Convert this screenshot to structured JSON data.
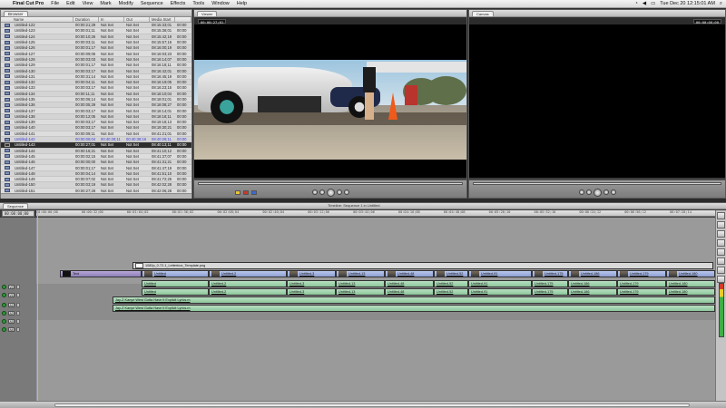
{
  "menubar": {
    "app": "Final Cut Pro",
    "items": [
      "File",
      "Edit",
      "View",
      "Mark",
      "Modify",
      "Sequence",
      "Effects",
      "Tools",
      "Window",
      "Help"
    ],
    "clock": "Tue Dec 20 12:15:01 AM"
  },
  "browser": {
    "tab": "Browser",
    "columns": [
      "Name",
      "Duration",
      "In",
      "Out",
      "Media Start",
      ""
    ],
    "rows": [
      {
        "name": "Untitled-122",
        "dur": "00:00:21;29",
        "in": "Not Set",
        "out": "Not Set",
        "mst": "08:15:33;01",
        "x": "00:00"
      },
      {
        "name": "Untitled-123",
        "dur": "00:00:01;11",
        "in": "Not Set",
        "out": "Not Set",
        "mst": "08:15:36;01",
        "x": "00:00"
      },
      {
        "name": "Untitled-124",
        "dur": "00:00:10;26",
        "in": "Not Set",
        "out": "Not Set",
        "mst": "08:15:42;19",
        "x": "00:00"
      },
      {
        "name": "Untitled-125",
        "dur": "00:00:03;11",
        "in": "Not Set",
        "out": "Not Set",
        "mst": "08:15:57;16",
        "x": "00:00"
      },
      {
        "name": "Untitled-126",
        "dur": "00:00:01;17",
        "in": "Not Set",
        "out": "Not Set",
        "mst": "08:16:00;19",
        "x": "00:00"
      },
      {
        "name": "Untitled-127",
        "dur": "00:00:09;06",
        "in": "Not Set",
        "out": "Not Set",
        "mst": "08:16:03;23",
        "x": "00:00"
      },
      {
        "name": "Untitled-128",
        "dur": "00:00:03;03",
        "in": "Not Set",
        "out": "Not Set",
        "mst": "08:16:14;07",
        "x": "00:00"
      },
      {
        "name": "Untitled-129",
        "dur": "00:00:01;17",
        "in": "Not Set",
        "out": "Not Set",
        "mst": "08:16:18;11",
        "x": "00:00"
      },
      {
        "name": "Untitled-130",
        "dur": "00:00:03;17",
        "in": "Not Set",
        "out": "Not Set",
        "mst": "08:16:42;01",
        "x": "00:00"
      },
      {
        "name": "Untitled-131",
        "dur": "00:00:31;14",
        "in": "Not Set",
        "out": "Not Set",
        "mst": "08:16:45;19",
        "x": "00:00"
      },
      {
        "name": "Untitled-132",
        "dur": "00:00:04;11",
        "in": "Not Set",
        "out": "Not Set",
        "mst": "08:16:19;05",
        "x": "00:00"
      },
      {
        "name": "Untitled-133",
        "dur": "00:00:03;17",
        "in": "Not Set",
        "out": "Not Set",
        "mst": "08:16:23;15",
        "x": "00:00"
      },
      {
        "name": "Untitled-134",
        "dur": "00:00:11;11",
        "in": "Not Set",
        "out": "Not Set",
        "mst": "08:18:10;04",
        "x": "00:00"
      },
      {
        "name": "Untitled-135",
        "dur": "00:00:06;14",
        "in": "Not Set",
        "out": "Not Set",
        "mst": "08:18:01;01",
        "x": "00:00"
      },
      {
        "name": "Untitled-136",
        "dur": "00:00:05;29",
        "in": "Not Set",
        "out": "Not Set",
        "mst": "08:18:08;27",
        "x": "00:00"
      },
      {
        "name": "Untitled-137",
        "dur": "00:00:03;17",
        "in": "Not Set",
        "out": "Not Set",
        "mst": "08:18:14;01",
        "x": "00:00"
      },
      {
        "name": "Untitled-138",
        "dur": "00:00:12;05",
        "in": "Not Set",
        "out": "Not Set",
        "mst": "08:18:18;11",
        "x": "00:00"
      },
      {
        "name": "Untitled-139",
        "dur": "00:00:03;17",
        "in": "Not Set",
        "out": "Not Set",
        "mst": "08:19:18;13",
        "x": "00:00"
      },
      {
        "name": "Untitled-140",
        "dur": "00:00:03;17",
        "in": "Not Set",
        "out": "Not Set",
        "mst": "08:19:30;21",
        "x": "00:00"
      },
      {
        "name": "Untitled-141",
        "dur": "00:00:09;11",
        "in": "Not Set",
        "out": "Not Set",
        "mst": "08:41:21;01",
        "x": "00:00"
      },
      {
        "name": "Untitled-142",
        "dur": "00:00:06;04",
        "in": "00:40:28;11",
        "out": "00:40:36;16",
        "mst": "08:40:28;11",
        "x": "00:00",
        "state": "hl"
      },
      {
        "name": "Untitled-143",
        "dur": "00:00:27;01",
        "in": "Not Set",
        "out": "Not Set",
        "mst": "08:40:13;11",
        "x": "00:00",
        "state": "sel"
      },
      {
        "name": "Untitled-144",
        "dur": "00:00:16;21",
        "in": "Not Set",
        "out": "Not Set",
        "mst": "08:41:10;12",
        "x": "00:00"
      },
      {
        "name": "Untitled-145",
        "dur": "00:00:02;15",
        "in": "Not Set",
        "out": "Not Set",
        "mst": "08:41:37;07",
        "x": "00:00"
      },
      {
        "name": "Untitled-146",
        "dur": "00:00:00;00",
        "in": "Not Set",
        "out": "Not Set",
        "mst": "08:41:31;21",
        "x": "00:00"
      },
      {
        "name": "Untitled-147",
        "dur": "00:00:01;17",
        "in": "Not Set",
        "out": "Not Set",
        "mst": "08:41:47;19",
        "x": "00:00"
      },
      {
        "name": "Untitled-148",
        "dur": "00:00:04;14",
        "in": "Not Set",
        "out": "Not Set",
        "mst": "08:41:51;10",
        "x": "00:00"
      },
      {
        "name": "Untitled-149",
        "dur": "00:00:07;02",
        "in": "Not Set",
        "out": "Not Set",
        "mst": "08:41:72;25",
        "x": "00:00"
      },
      {
        "name": "Untitled-150",
        "dur": "00:00:03;19",
        "in": "Not Set",
        "out": "Not Set",
        "mst": "08:42:02;28",
        "x": "00:00"
      },
      {
        "name": "Untitled-151",
        "dur": "00:00:27;28",
        "in": "Not Set",
        "out": "Not Set",
        "mst": "08:42:06;28",
        "x": "00:00"
      },
      {
        "name": "Untitled-152",
        "dur": "00:00:03;15",
        "in": "Not Set",
        "out": "Not Set",
        "mst": "08:42:14;13",
        "x": "00:00"
      },
      {
        "name": "Untitled-153",
        "dur": "00:00:03;13",
        "in": "Not Set",
        "out": "Not Set",
        "mst": "08:42:19;29",
        "x": "00:00"
      }
    ]
  },
  "viewer": {
    "tab": "Viewer",
    "duration": "00:00:27;01",
    "zoom": "26%",
    "timecode": "08:40:13;11"
  },
  "canvas": {
    "tab": "Canvas",
    "timecode": "00:00:00;00",
    "zoom": "26%"
  },
  "timeline": {
    "tab": "Sequence",
    "title": "Timeline: Sequence 1 in Untitled",
    "current_tc": "00:00:00;00",
    "ruler_ticks": [
      "00:00:00;00",
      "00:00:32;00",
      "00:01:04;02",
      "00:01:36;02",
      "00:02:08;04",
      "00:02:40;04",
      "00:03:12;06",
      "00:03:44;06",
      "00:04:16;08",
      "00:04:48;08",
      "00:05:20;10",
      "00:05:52;10",
      "00:06:24;12",
      "00:06:56;12",
      "00:07:28;14"
    ],
    "tracks": {
      "v2_label": "1080p_0.72-1_Letterbox_Template.png",
      "v1_title": "Text",
      "v1_clips": [
        "Untitled",
        "Untitled-2",
        "Untitled-3",
        "Untitled-13",
        "Untitled-48",
        "Untitled-52",
        "Untitled-91",
        "Untitled-175",
        "Untitled-186",
        "Untitled-179",
        "Untitled-180"
      ],
      "a1_clips": [
        "Untitled",
        "Untitled-2",
        "Untitled-3",
        "Untitled-13",
        "Untitled-48",
        "Untitled-52",
        "Untitled-91",
        "Untitled-175",
        "Untitled-186",
        "Untitled-179",
        "Untitled-180"
      ],
      "a2_clips": [
        "Untitled",
        "Untitled-2",
        "Untitled-3",
        "Untitled-13",
        "Untitled-48",
        "Untitled-52",
        "Untitled-91",
        "Untitled-175",
        "Untitled-186",
        "Untitled-179",
        "Untitled-180"
      ],
      "a3_label": "Jay-Z Kanye West Gotta Have It Explicit Lyrics.m",
      "a4_label": "Jay-Z Kanye West Gotta Have It Explicit Lyrics.m",
      "track_labels": [
        "V2",
        "V1",
        "A1",
        "A2",
        "A3",
        "A4"
      ]
    }
  },
  "colors": {
    "video_clip": "#9aaadd",
    "audio_clip": "#9ccfa8",
    "selected_row": "#2d2d2d"
  }
}
